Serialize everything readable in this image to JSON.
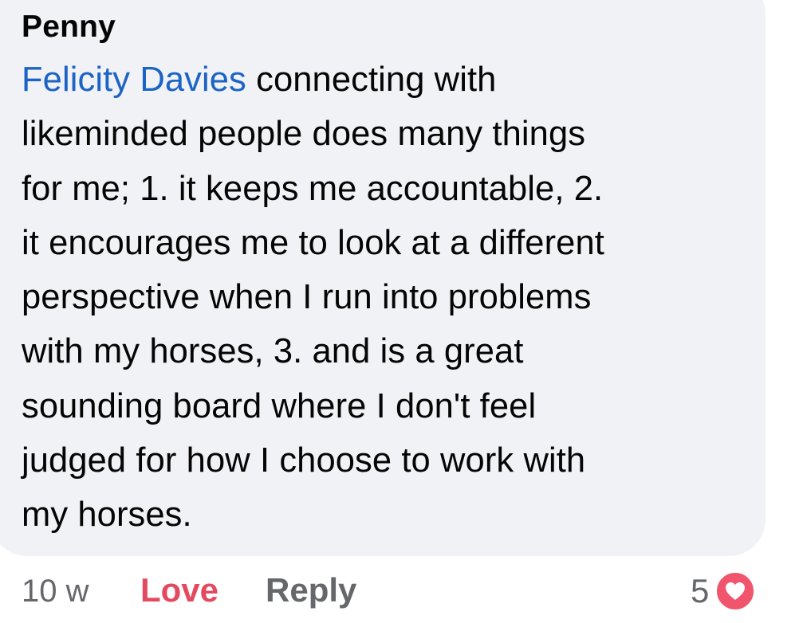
{
  "comment": {
    "author": "Penny",
    "mention": "Felicity Davies",
    "lines": [
      " connecting with",
      "likeminded people does many things",
      "for me; 1. it keeps me accountable, 2.",
      "it encourages me to look at a different",
      "perspective when I run into problems",
      "with my horses, 3. and is a great",
      "sounding board where I don't feel",
      "judged for how I choose to work with",
      "my horses."
    ]
  },
  "actions": {
    "time": "10 w",
    "love_label": "Love",
    "reply_label": "Reply",
    "reaction_count": "5",
    "reaction_icon": "heart-icon"
  },
  "colors": {
    "bubble": "#f0f2f5",
    "mention": "#1b63c4",
    "love": "#e34a60",
    "muted": "#65676b",
    "heart_badge": "#f0556d"
  }
}
